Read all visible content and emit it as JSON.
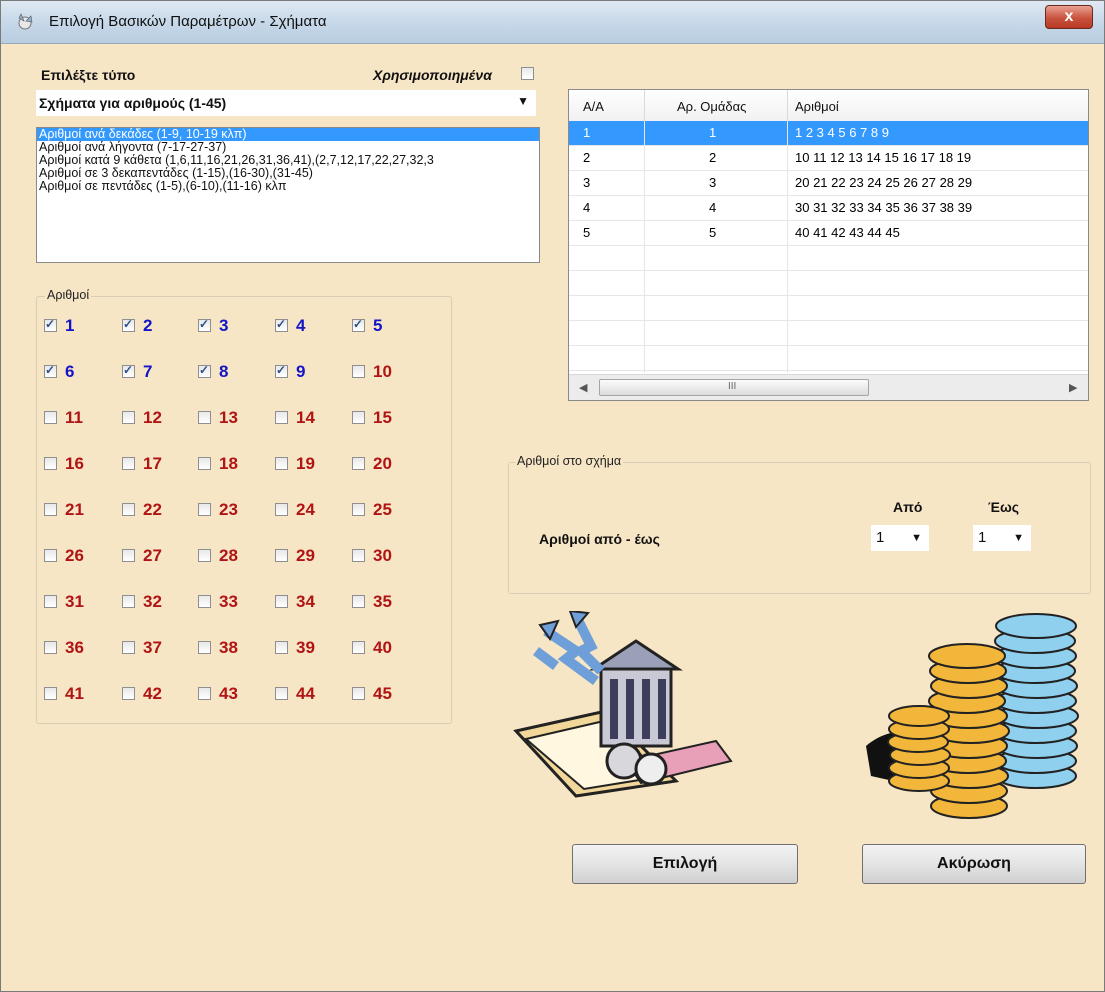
{
  "window": {
    "title": "Επιλογή Βασικών Παραμέτρων - Σχήματα",
    "close_label": "x",
    "app_icon": "satellite-icon"
  },
  "type_select": {
    "label": "Επιλέξτε τύπο",
    "used_label": "Χρησιμοποιημένα",
    "used_checked": false,
    "selected": "Σχήματα για αριθμούς (1-45)"
  },
  "shapes_list": {
    "selected_index": 0,
    "items": [
      "Αριθμοί ανά δεκάδες (1-9, 10-19 κλπ)",
      "Αριθμοί ανά λήγοντα (7-17-27-37)",
      "Αριθμοί κατά 9 κάθετα (1,6,11,16,21,26,31,36,41),(2,7,12,17,22,27,32,3",
      "Αριθμοί σε 3 δεκαπεντάδες (1-15),(16-30),(31-45)",
      "Αριθμοί σε πεντάδες (1-5),(6-10),(11-16) κλπ"
    ]
  },
  "numbers_group": {
    "title": "Αριθμοί",
    "numbers": [
      {
        "n": "1",
        "checked": true
      },
      {
        "n": "2",
        "checked": true
      },
      {
        "n": "3",
        "checked": true
      },
      {
        "n": "4",
        "checked": true
      },
      {
        "n": "5",
        "checked": true
      },
      {
        "n": "6",
        "checked": true
      },
      {
        "n": "7",
        "checked": true
      },
      {
        "n": "8",
        "checked": true
      },
      {
        "n": "9",
        "checked": true
      },
      {
        "n": "10",
        "checked": false
      },
      {
        "n": "11",
        "checked": false
      },
      {
        "n": "12",
        "checked": false
      },
      {
        "n": "13",
        "checked": false
      },
      {
        "n": "14",
        "checked": false
      },
      {
        "n": "15",
        "checked": false
      },
      {
        "n": "16",
        "checked": false
      },
      {
        "n": "17",
        "checked": false
      },
      {
        "n": "18",
        "checked": false
      },
      {
        "n": "19",
        "checked": false
      },
      {
        "n": "20",
        "checked": false
      },
      {
        "n": "21",
        "checked": false
      },
      {
        "n": "22",
        "checked": false
      },
      {
        "n": "23",
        "checked": false
      },
      {
        "n": "24",
        "checked": false
      },
      {
        "n": "25",
        "checked": false
      },
      {
        "n": "26",
        "checked": false
      },
      {
        "n": "27",
        "checked": false
      },
      {
        "n": "28",
        "checked": false
      },
      {
        "n": "29",
        "checked": false
      },
      {
        "n": "30",
        "checked": false
      },
      {
        "n": "31",
        "checked": false
      },
      {
        "n": "32",
        "checked": false
      },
      {
        "n": "33",
        "checked": false
      },
      {
        "n": "34",
        "checked": false
      },
      {
        "n": "35",
        "checked": false
      },
      {
        "n": "36",
        "checked": false
      },
      {
        "n": "37",
        "checked": false
      },
      {
        "n": "38",
        "checked": false
      },
      {
        "n": "39",
        "checked": false
      },
      {
        "n": "40",
        "checked": false
      },
      {
        "n": "41",
        "checked": false
      },
      {
        "n": "42",
        "checked": false
      },
      {
        "n": "43",
        "checked": false
      },
      {
        "n": "44",
        "checked": false
      },
      {
        "n": "45",
        "checked": false
      }
    ]
  },
  "grid": {
    "headers": [
      "A/A",
      "Αρ. Ομάδας",
      "Αριθμοί"
    ],
    "selected_row": 0,
    "rows": [
      [
        "1",
        "1",
        "1 2 3 4 5 6 7 8 9"
      ],
      [
        "2",
        "2",
        "10 11 12 13 14 15 16 17 18 19"
      ],
      [
        "3",
        "3",
        "20 21 22 23 24 25 26 27 28 29"
      ],
      [
        "4",
        "4",
        "30 31 32 33 34 35 36 37 38 39"
      ],
      [
        "5",
        "5",
        "40 41 42 43 44 45"
      ]
    ],
    "scroll_grip": "III"
  },
  "range_group": {
    "title": "Αριθμοί στο σχήμα",
    "label": "Αριθμοί από - έως",
    "from_label": "Από",
    "to_label": "Έως",
    "from_value": "1",
    "to_value": "1"
  },
  "clipart": [
    "bank-stocks-clipart",
    "coin-stacks-clipart"
  ],
  "buttons": {
    "select": "Επιλογή",
    "cancel": "Ακύρωση"
  },
  "colors": {
    "background": "#f7e6c6",
    "checked_number": "#1414c8",
    "unchecked_number": "#b01414",
    "selection": "#3399ff"
  }
}
